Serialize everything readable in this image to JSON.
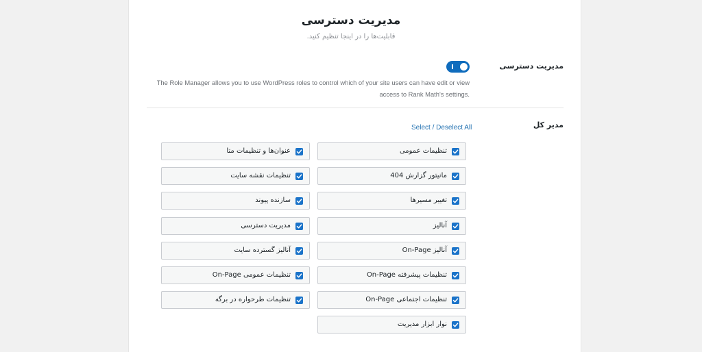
{
  "header": {
    "title": "مدیریت دسترسی",
    "subtitle": "قابلیت‌ها را در اینجا تنظیم کنید."
  },
  "role_manager": {
    "label": "مدیریت دسترسی",
    "toggle_on": true,
    "description": "The Role Manager allows you to use WordPress roles to control which of your site users can have edit or view access to Rank Math's settings."
  },
  "admin_caps": {
    "label": "مدیر کل",
    "select_all_link": "Select / Deselect All",
    "items": [
      {
        "label": "تنظیمات عمومی",
        "checked": true
      },
      {
        "label": "عنوان‌ها و تنظیمات متا",
        "checked": true
      },
      {
        "label": "مانیتور گزارش 404",
        "checked": true
      },
      {
        "label": "تنظیمات نقشه سایت",
        "checked": true
      },
      {
        "label": "تغییر مسیرها",
        "checked": true
      },
      {
        "label": "سازنده پیوند",
        "checked": true
      },
      {
        "label": "آنالیز",
        "checked": true
      },
      {
        "label": "مدیریت دسترسی",
        "checked": true
      },
      {
        "label": "آنالیز On-Page",
        "checked": true
      },
      {
        "label": "آنالیز گسترده سایت",
        "checked": true
      },
      {
        "label": "تنظیمات پیشرفته On-Page",
        "checked": true
      },
      {
        "label": "تنظیمات عمومی On-Page",
        "checked": true
      },
      {
        "label": "تنظیمات اجتماعی On-Page",
        "checked": true
      },
      {
        "label": "تنظیمات طرحواره در برگه",
        "checked": true
      },
      {
        "label": "نوار ابزار مدیریت",
        "checked": true
      }
    ]
  },
  "colors": {
    "accent": "#1a73c9",
    "toggle": "#0f6cbd",
    "link": "#2271b1"
  }
}
